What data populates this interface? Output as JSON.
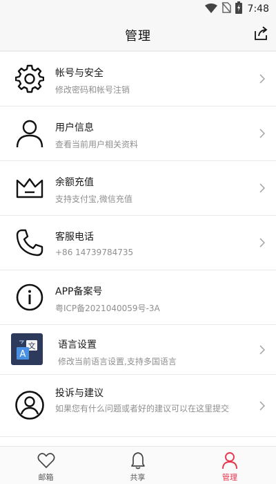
{
  "status_bar": {
    "time": "7:48",
    "icons": [
      "wifi-icon",
      "no-sim-icon",
      "battery-charging-icon"
    ]
  },
  "header": {
    "title": "管理",
    "share_icon": "share-export-icon"
  },
  "menu": {
    "items": [
      {
        "icon": "gear-icon",
        "title": "帐号与安全",
        "subtitle": "修改密码和帐号注销"
      },
      {
        "icon": "user-icon",
        "title": "用户信息",
        "subtitle": "查看当前用户相关资料"
      },
      {
        "icon": "crown-icon",
        "title": "余额充值",
        "subtitle": "支持支付宝,微信充值"
      },
      {
        "icon": "phone-icon",
        "title": "客服电话",
        "subtitle": "+86 14739784735"
      },
      {
        "icon": "info-icon",
        "title": "APP备案号",
        "subtitle": "粤ICP备2021040059号-3A"
      },
      {
        "icon": "translate-icon",
        "title": "语言设置",
        "subtitle": "修改当前语言设置,支持多国语言"
      },
      {
        "icon": "account-circle-icon",
        "title": "投诉与建议",
        "subtitle": "如果您有什么问题或者好的建议可以在这里提交"
      }
    ]
  },
  "tab_bar": {
    "tabs": [
      {
        "icon": "heart-icon",
        "label": "邮箱"
      },
      {
        "icon": "bell-icon",
        "label": "共享"
      },
      {
        "icon": "person-icon",
        "label": "管理",
        "active": true
      }
    ]
  },
  "colors": {
    "accent": "#e8334a",
    "translate_tile": "#2e3a5c"
  }
}
